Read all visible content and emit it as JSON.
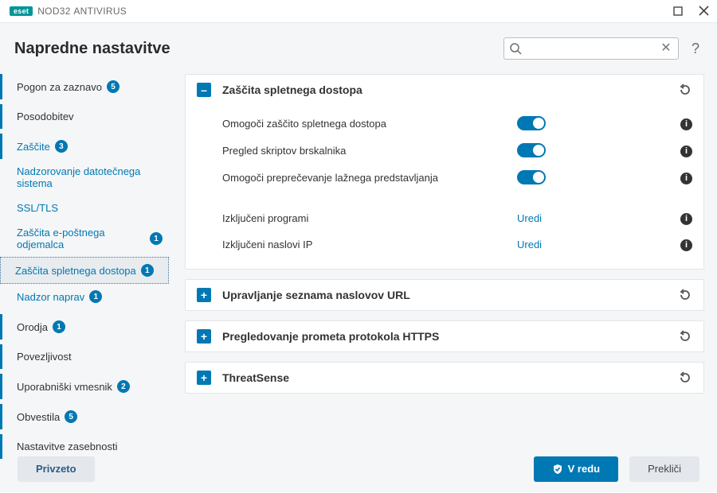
{
  "window": {
    "brand_eset": "eset",
    "brand_product": "NOD32",
    "brand_suffix": "ANTIVIRUS"
  },
  "header": {
    "title": "Napredne nastavitve",
    "search_value": "",
    "search_placeholder": "",
    "help_glyph": "?"
  },
  "sidebar": {
    "items": [
      {
        "label": "Pogon za zaznavo",
        "badge": "5",
        "type": "top",
        "accent": false,
        "barred": true
      },
      {
        "label": "Posodobitev",
        "badge": null,
        "type": "top",
        "accent": false,
        "barred": true
      },
      {
        "label": "Zaščite",
        "badge": "3",
        "type": "top",
        "accent": true,
        "barred": true
      },
      {
        "label": "Nadzorovanje datotečnega sistema",
        "badge": null,
        "type": "sub"
      },
      {
        "label": "SSL/TLS",
        "badge": null,
        "type": "sub"
      },
      {
        "label": "Zaščita e-poštnega odjemalca",
        "badge": "1",
        "type": "sub"
      },
      {
        "label": "Zaščita spletnega dostopa",
        "badge": "1",
        "type": "sub",
        "selected": true
      },
      {
        "label": "Nadzor naprav",
        "badge": "1",
        "type": "sub"
      },
      {
        "label": "Orodja",
        "badge": "1",
        "type": "top",
        "accent": false,
        "barred": true
      },
      {
        "label": "Povezljivost",
        "badge": null,
        "type": "top",
        "accent": false,
        "barred": true
      },
      {
        "label": "Uporabniški vmesnik",
        "badge": "2",
        "type": "top",
        "accent": false,
        "barred": true
      },
      {
        "label": "Obvestila",
        "badge": "5",
        "type": "top",
        "accent": false,
        "barred": true
      },
      {
        "label": "Nastavitve zasebnosti",
        "badge": null,
        "type": "top",
        "accent": false,
        "barred": true
      }
    ]
  },
  "panels": {
    "web_access": {
      "title": "Zaščita spletnega dostopa",
      "expanded": true,
      "rows": [
        {
          "label": "Omogoči zaščito spletnega dostopa",
          "kind": "toggle",
          "value": true
        },
        {
          "label": "Pregled skriptov brskalnika",
          "kind": "toggle",
          "value": true
        },
        {
          "label": "Omogoči preprečevanje lažnega predstavljanja",
          "kind": "toggle",
          "value": true
        }
      ],
      "link_rows": [
        {
          "label": "Izključeni programi",
          "action": "Uredi"
        },
        {
          "label": "Izključeni naslovi IP",
          "action": "Uredi"
        }
      ]
    },
    "url_mgmt": {
      "title": "Upravljanje seznama naslovov URL",
      "expanded": false
    },
    "https_scan": {
      "title": "Pregledovanje prometa protokola HTTPS",
      "expanded": false
    },
    "threatsense": {
      "title": "ThreatSense",
      "expanded": false
    }
  },
  "footer": {
    "default_btn": "Privzeto",
    "ok_btn": "V redu",
    "cancel_btn": "Prekliči"
  },
  "icons": {
    "minus": "–",
    "plus": "+",
    "info": "i",
    "clear": "✕"
  }
}
